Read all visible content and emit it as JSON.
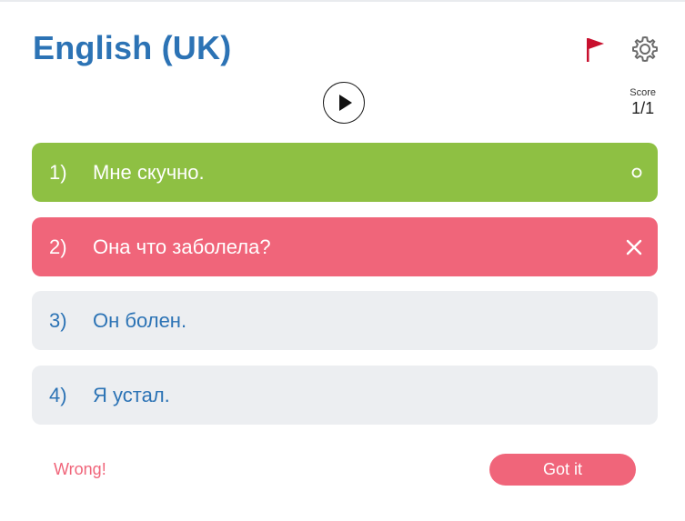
{
  "header": {
    "title": "English (UK)",
    "flag_icon": "flag-icon",
    "settings_icon": "gear-icon",
    "flag_color": "#c8102e"
  },
  "player": {
    "icon": "play-icon"
  },
  "score": {
    "label": "Score",
    "value": "1/1"
  },
  "options": [
    {
      "number": "1)",
      "text": "Мне скучно.",
      "state": "correct",
      "mark_icon": "circle-icon"
    },
    {
      "number": "2)",
      "text": "Она что заболела?",
      "state": "wrong",
      "mark_icon": "close-icon"
    },
    {
      "number": "3)",
      "text": "Он болен.",
      "state": "neutral"
    },
    {
      "number": "4)",
      "text": "Я устал.",
      "state": "neutral"
    }
  ],
  "footer": {
    "feedback": "Wrong!",
    "button_label": "Got it"
  },
  "colors": {
    "title": "#2c73b5",
    "correct": "#8ec043",
    "wrong": "#f0657a",
    "neutral": "#eceef1"
  }
}
